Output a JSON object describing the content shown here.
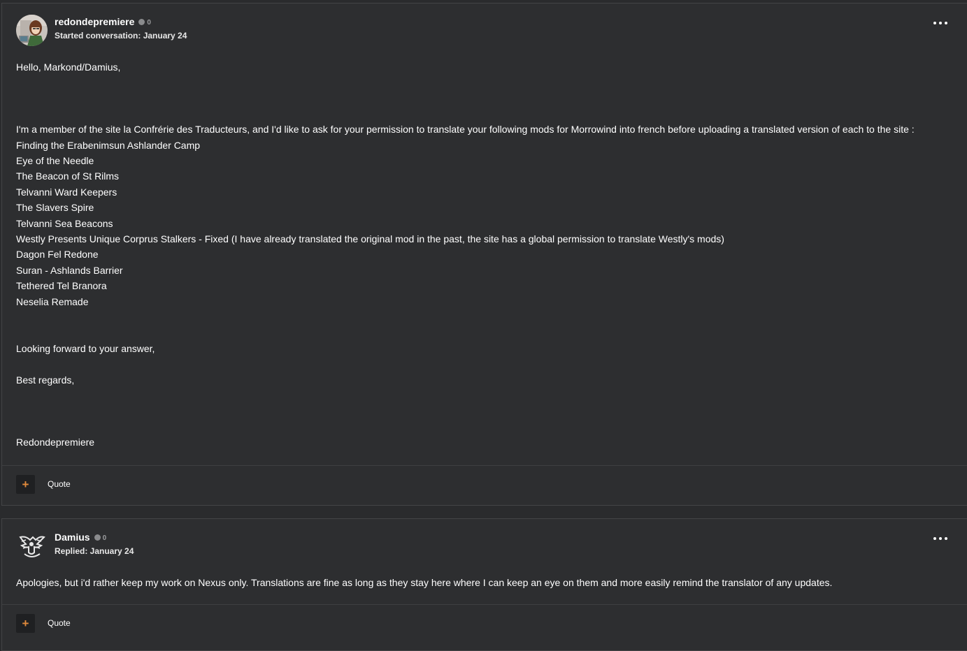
{
  "posts": [
    {
      "author": "redondepremiere",
      "reputation": "0",
      "meta": "Started conversation: January 24",
      "avatar_icon": "user-avatar-cartoon",
      "lines": [
        "Hello, Markond/Damius,",
        "I'm a member of the site la Confrérie des Traducteurs, and I'd like to ask for your permission to translate your following mods for Morrowind into french before uploading a translated version of each to the site :",
        "Finding the Erabenimsun Ashlander Camp",
        "Eye of the Needle",
        "The Beacon of St Rilms",
        "Telvanni Ward Keepers",
        "The Slavers Spire",
        "Telvanni Sea Beacons",
        "Westly Presents Unique Corprus Stalkers - Fixed (I have already translated the original mod in the past, the site has a global permission to translate Westly's mods)",
        "Dagon Fel Redone",
        "Suran - Ashlands Barrier",
        "Tethered Tel Branora",
        "Neselia Remade",
        "Looking forward to your answer,",
        "Best regards,",
        "Redondepremiere"
      ],
      "quote_label": "Quote",
      "plus_label": "+"
    },
    {
      "author": "Damius",
      "reputation": "0",
      "meta": "Replied: January 24",
      "avatar_icon": "emblem-avatar",
      "lines": [
        "Apologies, but i'd rather keep my work on Nexus only. Translations are fine as long as they stay here where I can keep an eye on them and more easily remind the translator of any updates."
      ],
      "quote_label": "Quote",
      "plus_label": "+"
    }
  ],
  "colors": {
    "background": "#2a2b2d",
    "post_background": "#2d2e30",
    "accent": "#e08a3c"
  }
}
